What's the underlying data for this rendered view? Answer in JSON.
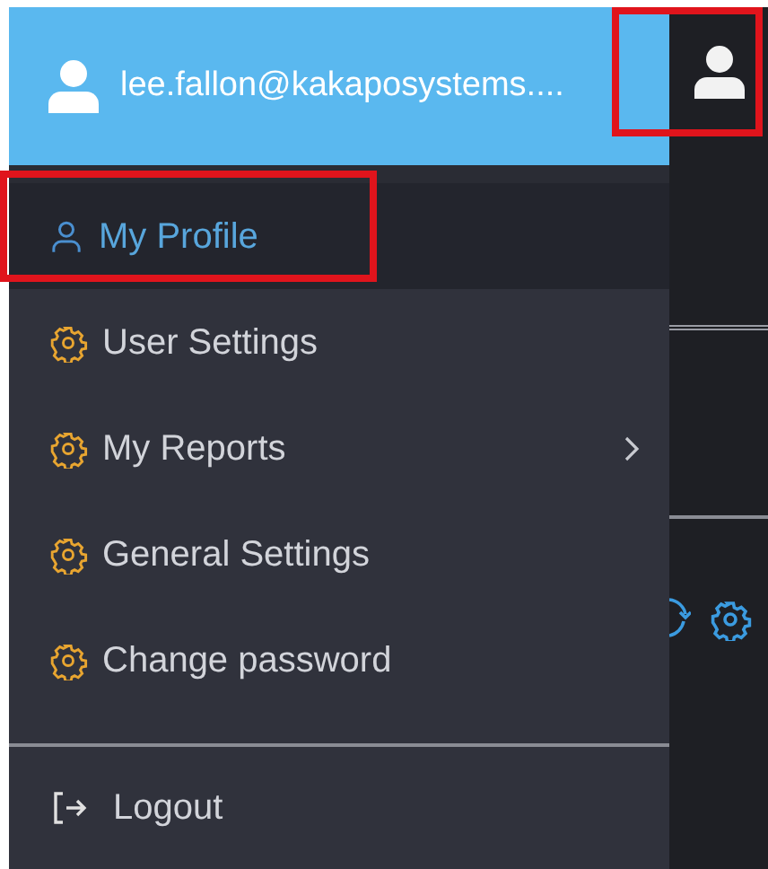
{
  "header": {
    "email": "lee.fallon@kakaposystems...."
  },
  "avatar_button": {
    "highlighted": true
  },
  "menu": [
    {
      "kind": "profile",
      "label": "My Profile",
      "selected": true,
      "highlighted": true,
      "submenu": false
    },
    {
      "kind": "gear",
      "label": "User Settings",
      "selected": false,
      "highlighted": false,
      "submenu": false
    },
    {
      "kind": "gear",
      "label": "My Reports",
      "selected": false,
      "highlighted": false,
      "submenu": true
    },
    {
      "kind": "gear",
      "label": "General Settings",
      "selected": false,
      "highlighted": false,
      "submenu": false
    },
    {
      "kind": "gear",
      "label": "Change password",
      "selected": false,
      "highlighted": false,
      "submenu": false
    }
  ],
  "logout": {
    "label": "Logout"
  }
}
